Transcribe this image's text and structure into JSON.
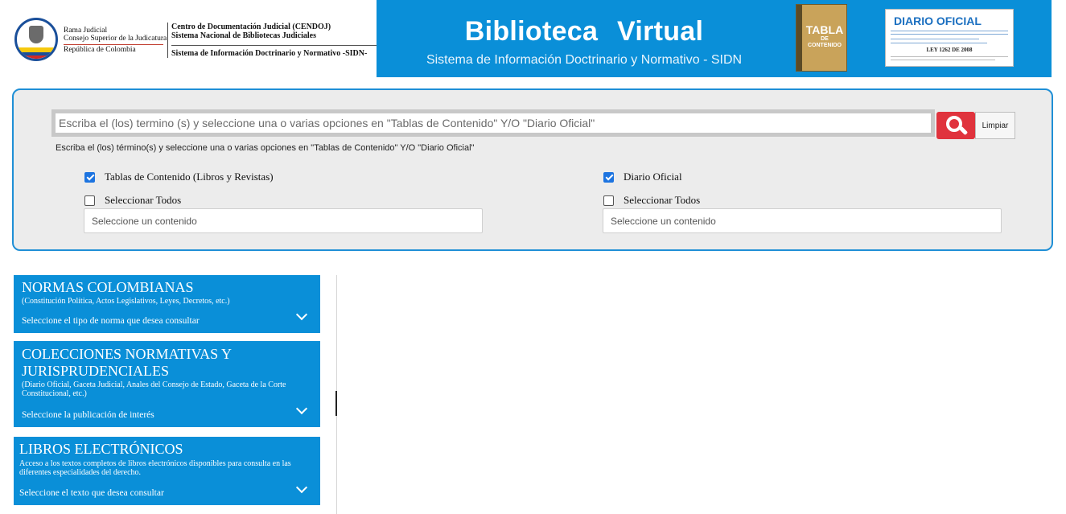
{
  "header": {
    "rama_lines": [
      "Rama Judicial",
      "Consejo Superior de la Judicatura"
    ],
    "republica": "República de Colombia",
    "cendoj_lines": [
      "Centro de Documentación Judicial (CENDOJ)",
      "Sistema Nacional de Bibliotecas Judiciales"
    ],
    "sidn_line": "Sistema de Información Doctrinario y Normativo -SIDN-",
    "title": "Biblioteca Virtual",
    "subtitle": "Sistema de Información Doctrinario y Normativo - SIDN",
    "tabla_book": {
      "line1": "TABLA",
      "line2a": "DE",
      "line2b": "CONTENIDO"
    },
    "diario": {
      "title": "DIARIO OFICIAL",
      "ley": "LEY 1262 DE 2008"
    },
    "colors": {
      "brand_blue": "#0a8fd8",
      "accent_red": "#e0333d"
    }
  },
  "search": {
    "placeholder": "Escriba el (los) termino (s) y seleccione una o varias opciones en \"Tablas de Contenido\" Y/O \"Diario Oficial\"",
    "value": "",
    "button_icon": "search-icon",
    "clear_label": "Limpiar",
    "help": "Escriba el (los) término(s) y seleccione una o varias opciones en \"Tablas de Contenido\" Y/O \"Diario Oficial\""
  },
  "filters": {
    "tablas": {
      "label": "Tablas de Contenido (Libros y Revistas)",
      "checked": true
    },
    "tablas_all": {
      "label": "Seleccionar Todos",
      "checked": false
    },
    "tablas_select": "Seleccione un contenido",
    "diario": {
      "label": "Diario Oficial",
      "checked": true
    },
    "diario_all": {
      "label": "Seleccionar Todos",
      "checked": false
    },
    "diario_select": "Seleccione un contenido"
  },
  "sections": [
    {
      "title": "NORMAS COLOMBIANAS",
      "desc": "(Constitución Política, Actos Legislativos, Leyes, Decretos, etc.)",
      "hint": "Seleccione el tipo de norma que desea consultar"
    },
    {
      "title": "COLECCIONES NORMATIVAS Y JURISPRUDENCIALES",
      "desc": "(Diario Oficial, Gaceta Judicial, Anales del Consejo de Estado, Gaceta de la Corte Constitucional, etc.)",
      "hint": "Seleccione la publicación de interés"
    },
    {
      "title": "LIBROS ELECTRÓNICOS",
      "desc": "Acceso a los textos completos de libros electrónicos disponibles para consulta en las diferentes especialidades del derecho.",
      "hint": "Seleccione el texto que desea consultar"
    }
  ]
}
